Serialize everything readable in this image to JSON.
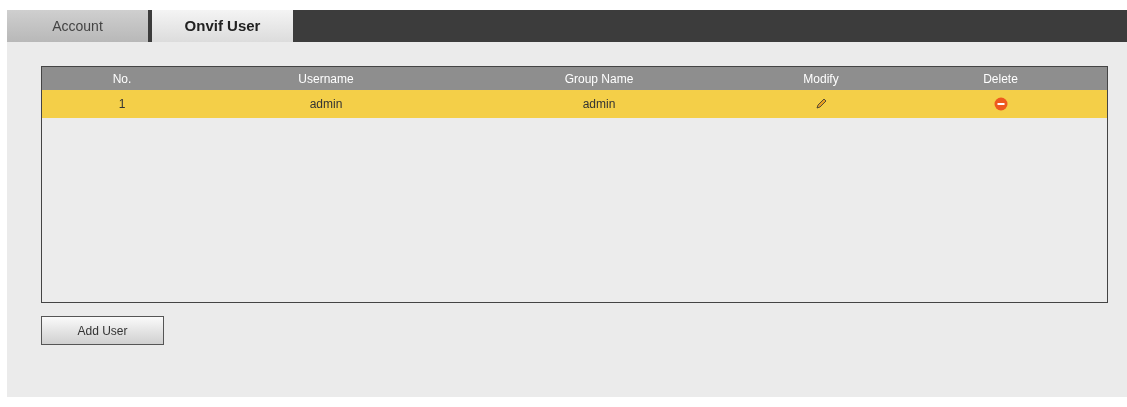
{
  "tabs": [
    {
      "label": "Account",
      "selected": false
    },
    {
      "label": "Onvif User",
      "selected": true
    }
  ],
  "table": {
    "columns": [
      "No.",
      "Username",
      "Group Name",
      "Modify",
      "Delete"
    ],
    "rows": [
      {
        "no": "1",
        "username": "admin",
        "group_name": "admin",
        "selected": true
      }
    ]
  },
  "buttons": [
    "Add User"
  ]
}
